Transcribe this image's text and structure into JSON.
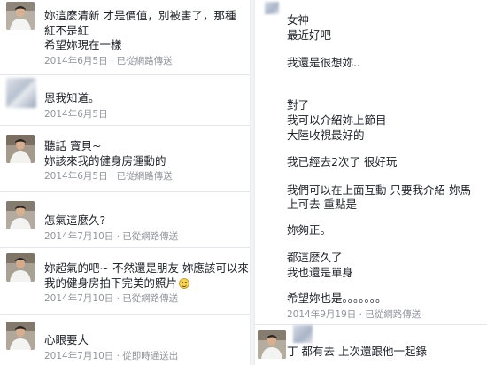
{
  "left": {
    "messages": [
      {
        "lines": [
          "妳這麼清新 才是價值，別被害了，那種",
          "紅不是紅",
          "希望妳現在一樣"
        ],
        "meta": "2014年6月5日 · 已從網路傳送"
      },
      {
        "lines": [
          "恩我知道。"
        ],
        "meta": "2014年6月5日"
      },
      {
        "lines": [
          "聽話 寶貝~",
          "妳該來我的健身房運動的"
        ],
        "meta": "2014年6月5日 · 已從網路傳送"
      },
      {
        "lines": [
          "怎氣這麼久?"
        ],
        "meta": "2014年7月10日 · 已從網路傳送"
      },
      {
        "lines": [
          "妳超氣的吧~ 不然還是朋友 妳應該可以來",
          "我的健身房拍下完美的照片"
        ],
        "meta": "2014年7月10日 · 已從網路傳送"
      },
      {
        "lines": [
          "心眼要大"
        ],
        "meta": "2014年7月10日 · 從即時通送出"
      }
    ]
  },
  "right": {
    "lines": [
      "女神",
      "最近好吧",
      "我還是很想妳..",
      "對了",
      "我可以介紹妳上節目",
      "大陸收視最好的",
      "我已經去2次了 很好玩",
      "我們可以在上面互動 只要我介紹   妳馬",
      "上可去 重點是",
      "妳夠正。",
      "都這麼久了",
      "我也還是單身",
      "希望妳也是。。。。。。。"
    ],
    "meta": "2014年9月19日 · 已從網路傳送",
    "partial_line": "丁   都有去    上次還跟他一起錄"
  }
}
